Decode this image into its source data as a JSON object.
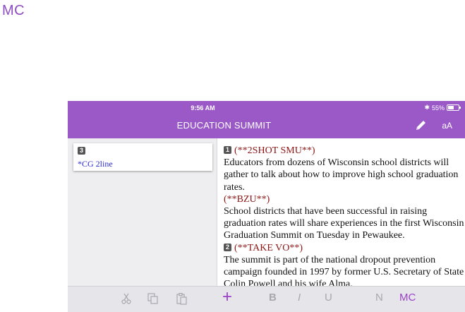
{
  "corner_label": "MC",
  "status_bar": {
    "time": "9:56 AM",
    "battery": "55%"
  },
  "header": {
    "title": "EDUCATION SUMMIT",
    "text_size_label": "aA"
  },
  "sidebar": {
    "cards": [
      {
        "number": "3",
        "text": "*CG 2line"
      }
    ]
  },
  "script": {
    "badge_1": "1",
    "cue_1": "(**2SHOT SMU**)",
    "para_1": "Educators from dozens of Wisconsin school districts will gather to talk about how to improve high school graduation rates.",
    "cue_2": "(**BZU**)",
    "para_2": "School districts that have been successful in raising graduation rates will share experiences in the first Wisconsin Graduation Summit on Tuesday in Pewaukee.",
    "badge_2": "2",
    "cue_3": "(**TAKE VO**)",
    "para_3": "The summit is part of the national dropout prevention campaign founded in 1997 by former U.S. Secretary of State Colin Powell and his wife Alma."
  },
  "toolbar": {
    "add": "+",
    "bold": "B",
    "italic": "I",
    "underline": "U",
    "normal": "N",
    "mc": "MC"
  },
  "colors": {
    "accent": "#9b59c8",
    "cue": "#8b1515",
    "cg_text": "#2c2ccc"
  }
}
